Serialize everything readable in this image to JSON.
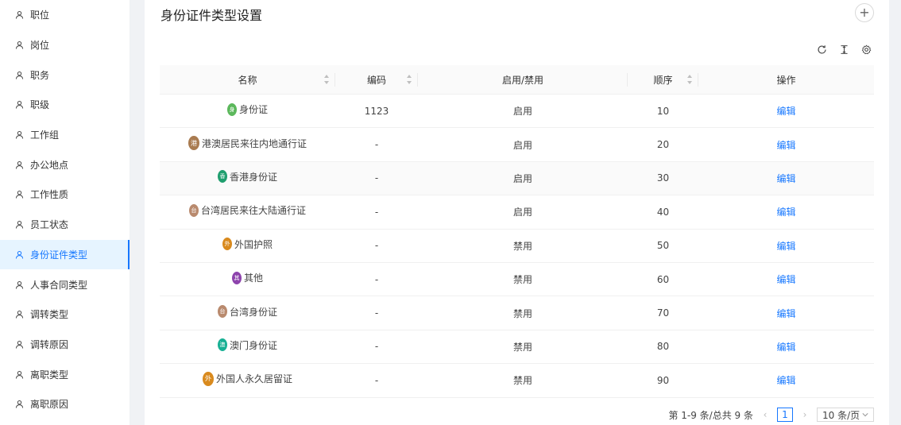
{
  "sidebar": {
    "items": [
      {
        "label": "职位"
      },
      {
        "label": "岗位"
      },
      {
        "label": "职务"
      },
      {
        "label": "职级"
      },
      {
        "label": "工作组"
      },
      {
        "label": "办公地点"
      },
      {
        "label": "工作性质"
      },
      {
        "label": "员工状态"
      },
      {
        "label": "身份证件类型",
        "active": true
      },
      {
        "label": "人事合同类型"
      },
      {
        "label": "调转类型"
      },
      {
        "label": "调转原因"
      },
      {
        "label": "离职类型"
      },
      {
        "label": "离职原因"
      }
    ]
  },
  "page": {
    "title": "身份证件类型设置",
    "add_label": "+"
  },
  "table": {
    "columns": [
      "名称",
      "编码",
      "启用/禁用",
      "顺序",
      "操作"
    ],
    "rows": [
      {
        "badge": "身",
        "badge_color": "#5cb85c",
        "small": true,
        "name": "身份证",
        "code": "1123",
        "status": "启用",
        "order": "10",
        "action": "编辑"
      },
      {
        "badge": "港",
        "badge_color": "#a97b50",
        "small": false,
        "name": "港澳居民来往内地通行证",
        "code": "-",
        "status": "启用",
        "order": "20",
        "action": "编辑"
      },
      {
        "badge": "香",
        "badge_color": "#1f9e6e",
        "small": true,
        "name": "香港身份证",
        "code": "-",
        "status": "启用",
        "order": "30",
        "action": "编辑"
      },
      {
        "badge": "台",
        "badge_color": "#b98a6e",
        "small": true,
        "name": "台湾居民来往大陆通行证",
        "code": "-",
        "status": "启用",
        "order": "40",
        "action": "编辑"
      },
      {
        "badge": "外",
        "badge_color": "#d98a1e",
        "small": true,
        "name": "外国护照",
        "code": "-",
        "status": "禁用",
        "order": "50",
        "action": "编辑"
      },
      {
        "badge": "其",
        "badge_color": "#8e44ad",
        "small": true,
        "name": "其他",
        "code": "-",
        "status": "禁用",
        "order": "60",
        "action": "编辑"
      },
      {
        "badge": "台",
        "badge_color": "#b98a6e",
        "small": true,
        "name": "台湾身份证",
        "code": "-",
        "status": "禁用",
        "order": "70",
        "action": "编辑"
      },
      {
        "badge": "澳",
        "badge_color": "#18b094",
        "small": true,
        "name": "澳门身份证",
        "code": "-",
        "status": "禁用",
        "order": "80",
        "action": "编辑"
      },
      {
        "badge": "外",
        "badge_color": "#d98a1e",
        "small": false,
        "name": "外国人永久居留证",
        "code": "-",
        "status": "禁用",
        "order": "90",
        "action": "编辑"
      }
    ]
  },
  "pagination": {
    "summary": "第 1-9 条/总共 9 条",
    "prev": "‹",
    "current": "1",
    "next": "›",
    "page_size": "10 条/页"
  },
  "colors": {
    "accent": "#1677ff"
  }
}
